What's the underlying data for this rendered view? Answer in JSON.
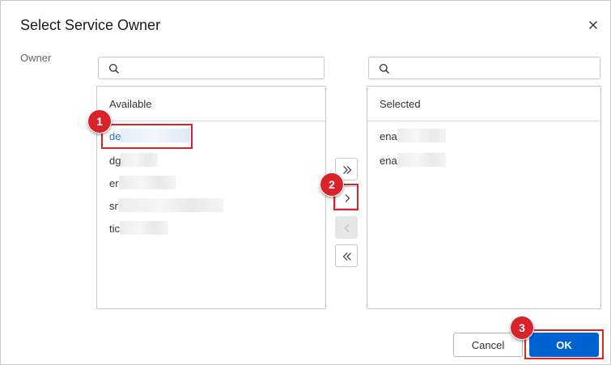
{
  "dialog": {
    "title": "Select Service Owner",
    "owner_label": "Owner"
  },
  "available": {
    "search_placeholder": "",
    "header": "Available",
    "items": [
      "de",
      "dg",
      "er",
      "sr",
      "tic"
    ]
  },
  "selected": {
    "search_placeholder": "",
    "header": "Selected",
    "items": [
      "ena",
      "ena"
    ]
  },
  "transfer": {
    "move_all_right": "»",
    "move_right": "›",
    "move_left": "‹",
    "move_all_left": "«"
  },
  "buttons": {
    "cancel": "Cancel",
    "ok": "OK"
  },
  "annotations": {
    "step1": "1",
    "step2": "2",
    "step3": "3",
    "color": "#d9232a"
  },
  "colors": {
    "primary": "#0062d1",
    "link": "#1e6fc9"
  }
}
